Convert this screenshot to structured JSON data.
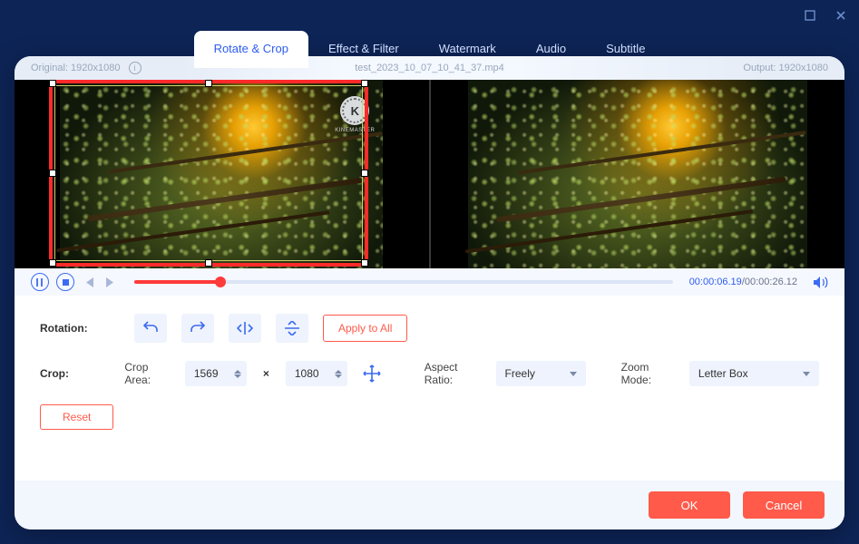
{
  "window": {
    "maximize": "□",
    "close": "×"
  },
  "tabs": {
    "rotate_crop": "Rotate & Crop",
    "effect_filter": "Effect & Filter",
    "watermark": "Watermark",
    "audio": "Audio",
    "subtitle": "Subtitle"
  },
  "infobar": {
    "original_label": "Original:",
    "original_value": "1920x1080",
    "filename": "test_2023_10_07_10_41_37.mp4",
    "output_label": "Output:",
    "output_value": "1920x1080"
  },
  "watermark_brand": "KINEMASTER",
  "watermark_k": "K",
  "player": {
    "current": "00:00:06.19",
    "sep": "/",
    "total": "00:00:26.12"
  },
  "rotation": {
    "label": "Rotation:",
    "apply_all": "Apply to All"
  },
  "crop": {
    "label": "Crop:",
    "area_label": "Crop Area:",
    "width": "1569",
    "height": "1080",
    "aspect_label": "Aspect Ratio:",
    "aspect_value": "Freely",
    "zoom_label": "Zoom Mode:",
    "zoom_value": "Letter Box"
  },
  "reset": "Reset",
  "footer": {
    "ok": "OK",
    "cancel": "Cancel"
  }
}
